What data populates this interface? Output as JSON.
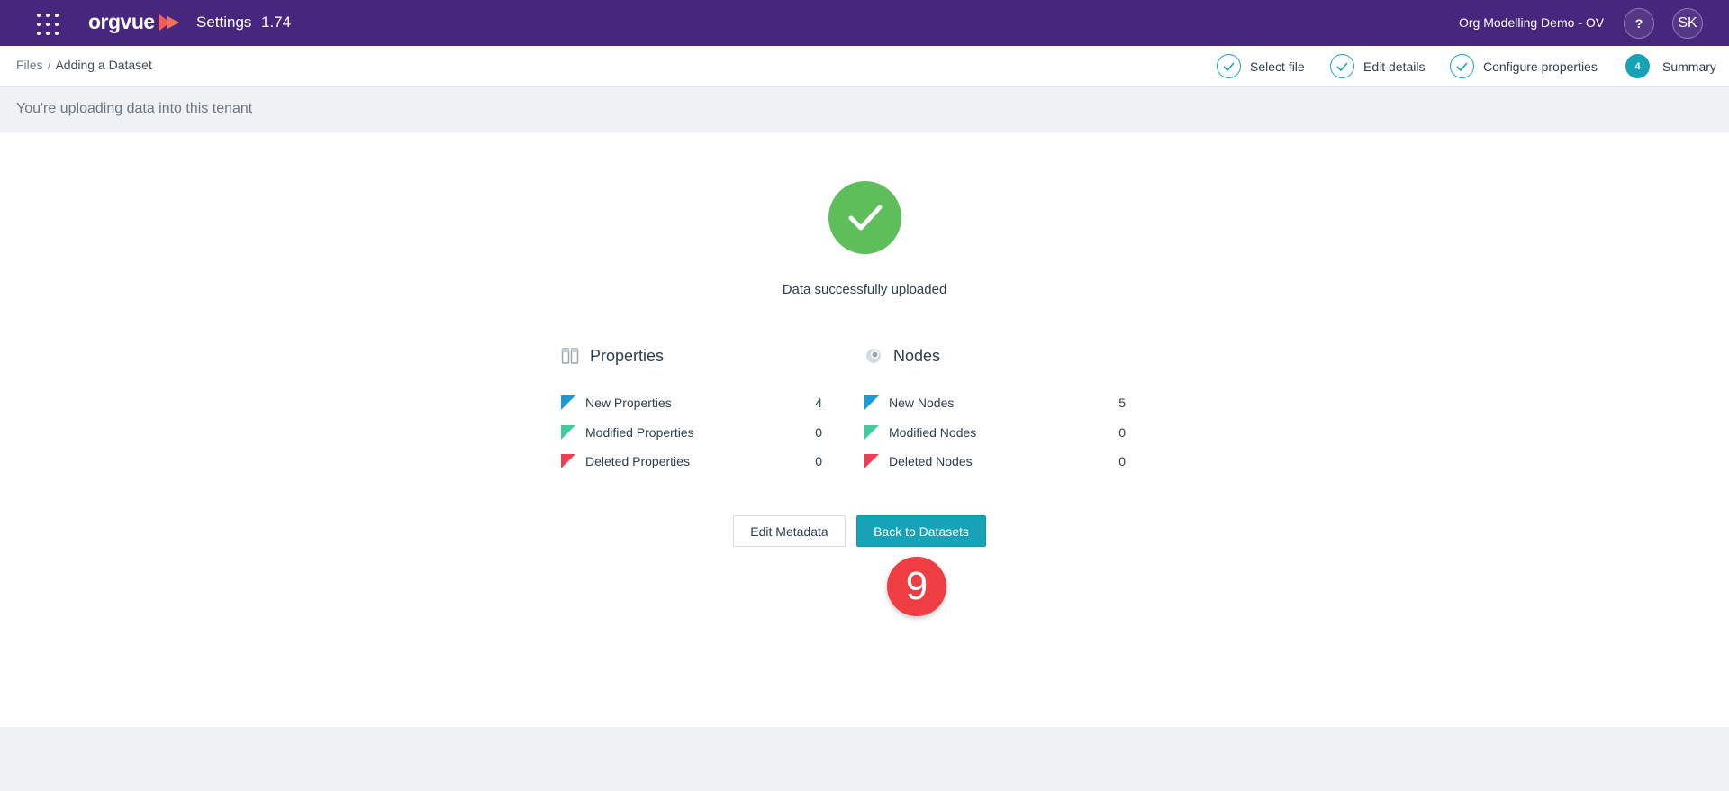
{
  "header": {
    "logo": "orgvue",
    "app_name": "Settings",
    "version": "1.74",
    "tenant": "Org Modelling Demo - OV",
    "help_label": "?",
    "avatar_initials": "SK"
  },
  "breadcrumb": {
    "root": "Files",
    "separator": "/",
    "current": "Adding a Dataset"
  },
  "steps": [
    {
      "label": "Select file",
      "status": "done"
    },
    {
      "label": "Edit details",
      "status": "done"
    },
    {
      "label": "Configure properties",
      "status": "done"
    },
    {
      "label": "Summary",
      "number": "4",
      "status": "current"
    }
  ],
  "notice": "You're uploading data into this tenant",
  "result": {
    "message": "Data successfully uploaded"
  },
  "properties": {
    "title": "Properties",
    "rows": [
      {
        "label": "New Properties",
        "value": "4",
        "color": "#1a9bd7"
      },
      {
        "label": "Modified Properties",
        "value": "0",
        "color": "#3ccf9a"
      },
      {
        "label": "Deleted Properties",
        "value": "0",
        "color": "#ee3e54"
      }
    ]
  },
  "nodes": {
    "title": "Nodes",
    "rows": [
      {
        "label": "New Nodes",
        "value": "5",
        "color": "#1a9bd7"
      },
      {
        "label": "Modified Nodes",
        "value": "0",
        "color": "#3ccf9a"
      },
      {
        "label": "Deleted Nodes",
        "value": "0",
        "color": "#ee3e54"
      }
    ]
  },
  "actions": {
    "edit_metadata": "Edit Metadata",
    "back_to_datasets": "Back to Datasets"
  },
  "step_badge": "9",
  "colors": {
    "header_bg": "#47277d",
    "accent": "#16a3b8",
    "success": "#5dbe5a",
    "badge": "#ee3e44"
  }
}
